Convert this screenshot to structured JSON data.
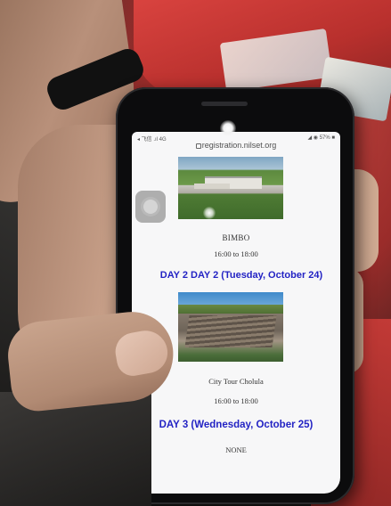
{
  "status_bar": {
    "carrier": "◂ 飞信 .ıl 4G",
    "right": "◢ ◉ 57% ■"
  },
  "browser": {
    "url": "registration.nilset.org"
  },
  "schedule": {
    "event1": {
      "name": "BIMBO",
      "time": "16:00 to 18:00"
    },
    "day2": "DAY 2 DAY 2 (Tuesday, October 24)",
    "event2": {
      "name": "City Tour Cholula",
      "time": "16:00 to 18:00"
    },
    "day3": "DAY 3 (Wednesday, October 25)",
    "day3_event": "NONE"
  },
  "colors": {
    "day_heading": "#2323c4",
    "page_background": "#f7f7f8"
  },
  "icons": {
    "assistive_touch": "assistive-touch-icon",
    "lock": "lock-icon"
  }
}
